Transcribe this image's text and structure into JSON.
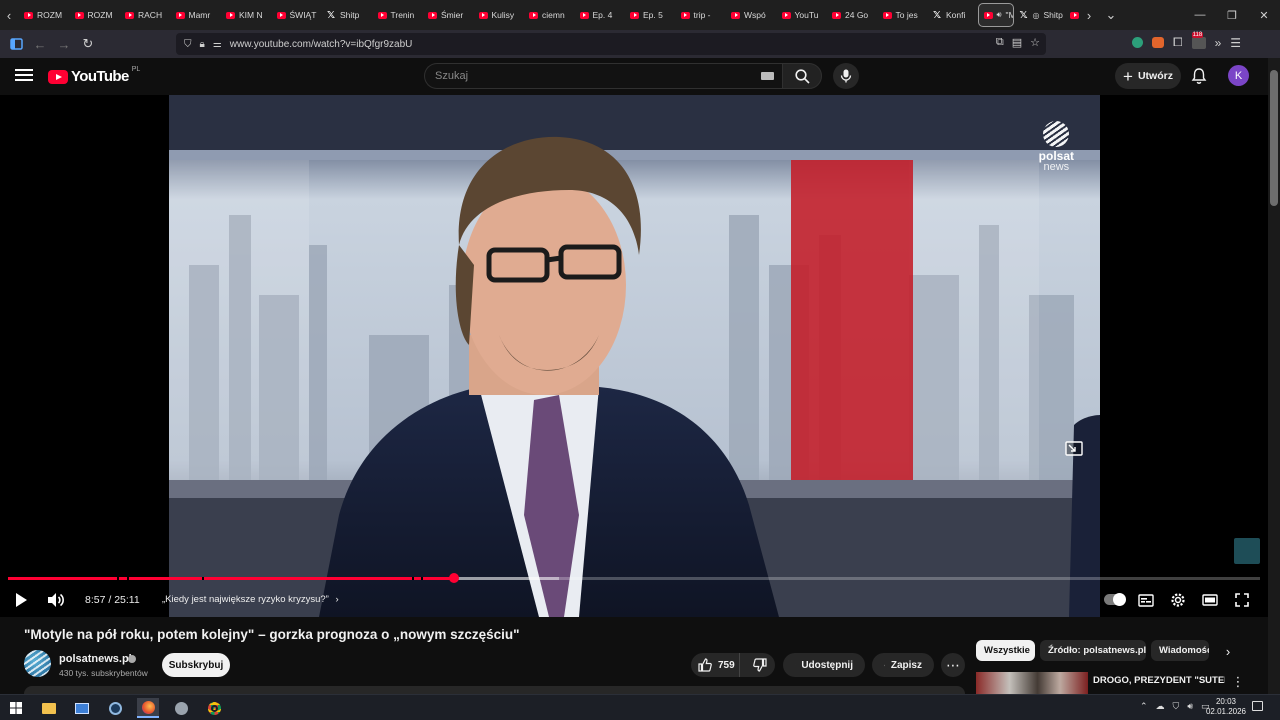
{
  "browser": {
    "tabs": [
      {
        "label": "ROZM",
        "icon": "youtube-icon"
      },
      {
        "label": "ROZM",
        "icon": "youtube-icon"
      },
      {
        "label": "RACH",
        "icon": "youtube-icon"
      },
      {
        "label": "Mamr",
        "icon": "youtube-icon"
      },
      {
        "label": "KIM N",
        "icon": "youtube-icon"
      },
      {
        "label": "ŚWIĄT",
        "icon": "youtube-icon"
      },
      {
        "label": "Shitp",
        "icon": "x-icon"
      },
      {
        "label": "Trenin",
        "icon": "youtube-icon"
      },
      {
        "label": "Śmier",
        "icon": "youtube-icon"
      },
      {
        "label": "Kulisy",
        "icon": "youtube-icon"
      },
      {
        "label": "ciemn",
        "icon": "youtube-icon"
      },
      {
        "label": "Ep. 4",
        "icon": "youtube-icon"
      },
      {
        "label": "Ep. 5",
        "icon": "youtube-icon"
      },
      {
        "label": "trip -",
        "icon": "youtube-icon"
      },
      {
        "label": "Wspó",
        "icon": "youtube-icon"
      },
      {
        "label": "YouTu",
        "icon": "youtube-icon"
      },
      {
        "label": "24 Go",
        "icon": "youtube-icon"
      },
      {
        "label": "To jes",
        "icon": "youtube-icon"
      },
      {
        "label": "Konfi",
        "icon": "x-icon"
      }
    ],
    "active_tab": {
      "label": "\"Mo",
      "icon": "youtube-icon",
      "audio_icon": "speaker-icon",
      "close_icon": "close-icon"
    },
    "after_tabs": [
      {
        "label": "Shitp",
        "icon": "x-icon"
      }
    ],
    "url": "www.youtube.com/watch?v=ibQfgr9zabU",
    "extension_badge": "118"
  },
  "youtube": {
    "logo_text": "YouTube",
    "country_code": "PL",
    "search_placeholder": "Szukaj",
    "create_label": "Utwórz",
    "avatar_letter": "K"
  },
  "player": {
    "watermark": {
      "name": "polsat",
      "sub": "news"
    },
    "current_time": "8:57",
    "duration": "25:11",
    "time_display": "8:57 / 25:11",
    "chapter_title": "„Kiedy jest największe ryzyko kryzysu?”",
    "progress_fraction": 0.356,
    "buffered_fraction": 0.44,
    "chapter_breaks": [
      0.087,
      0.095,
      0.155,
      0.323,
      0.33
    ],
    "hd_badge": "HD"
  },
  "video": {
    "title": "\"Motyle na pół roku, potem kolejny\" – gorzka prognoza o „nowym szczęściu\"",
    "channel_name": "polsatnews.pl",
    "subscribers": "430 tys. subskrybentów",
    "subscribe_label": "Subskrybuj",
    "likes": "759",
    "share_label": "Udostępnij",
    "save_label": "Zapisz"
  },
  "sidebar": {
    "chips": [
      "Wszystkie",
      "Źródło: polsatnews.pl",
      "Wiadomości"
    ],
    "recommendation_title": "DROGO, PREZYDENT \"SUTENER\" I FALA UKRAIŃCÓW"
  },
  "taskbar": {
    "time": "20:03",
    "date": "02.01.2026"
  }
}
